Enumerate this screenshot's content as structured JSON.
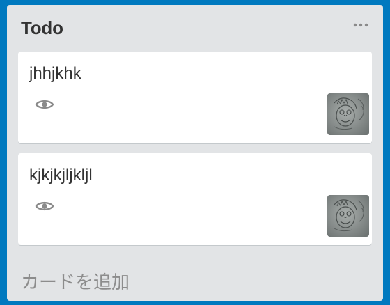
{
  "list": {
    "title": "Todo",
    "menu_icon": "more-horizontal-icon",
    "cards": [
      {
        "title": "jhhjkhk",
        "badge_icon": "eye-icon",
        "thumbnail": "sketch-face-thumbnail"
      },
      {
        "title": "kjkjkjljkljl",
        "badge_icon": "eye-icon",
        "thumbnail": "sketch-face-thumbnail"
      }
    ],
    "add_card_label": "カードを追加"
  },
  "colors": {
    "board_background": "#0079bf",
    "list_background": "#e2e4e6",
    "card_background": "#ffffff",
    "title_text": "#333333",
    "muted_text": "#8c8c8c"
  }
}
